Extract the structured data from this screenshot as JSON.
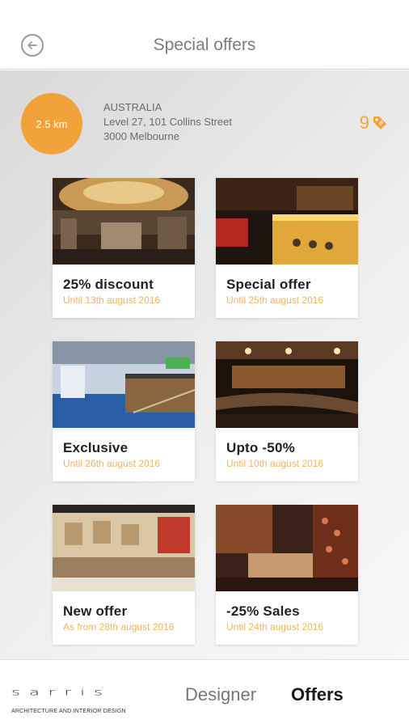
{
  "header": {
    "title": "Special offers",
    "back_icon": "arrow-left-circle-icon"
  },
  "location": {
    "distance": "2.5 km",
    "country": "AUSTRALIA",
    "street": "Level 27, 101 Collins Street",
    "city": "3000 Melbourne",
    "offer_count": "9",
    "offer_icon": "tag-icon"
  },
  "offers": [
    {
      "title": "25% discount",
      "date": "Until 13th august 2016"
    },
    {
      "title": "Special offer",
      "date": "Until 25th august 2016"
    },
    {
      "title": "Exclusive",
      "date": "Until 26th august 2016"
    },
    {
      "title": "Upto -50%",
      "date": "Until 10th august 2016"
    },
    {
      "title": "New offer",
      "date": "As from 28th august 2016"
    },
    {
      "title": "-25% Sales",
      "date": "Until 24th august 2016"
    }
  ],
  "footer": {
    "brand": "sarris",
    "tagline": "ARCHITECTURE AND INTERIOR DESIGN",
    "nav_designer": "Designer",
    "nav_offers": "Offers"
  },
  "colors": {
    "accent": "#f2a23a",
    "date_text": "#f2b463",
    "header_text": "#7d7d7d"
  }
}
